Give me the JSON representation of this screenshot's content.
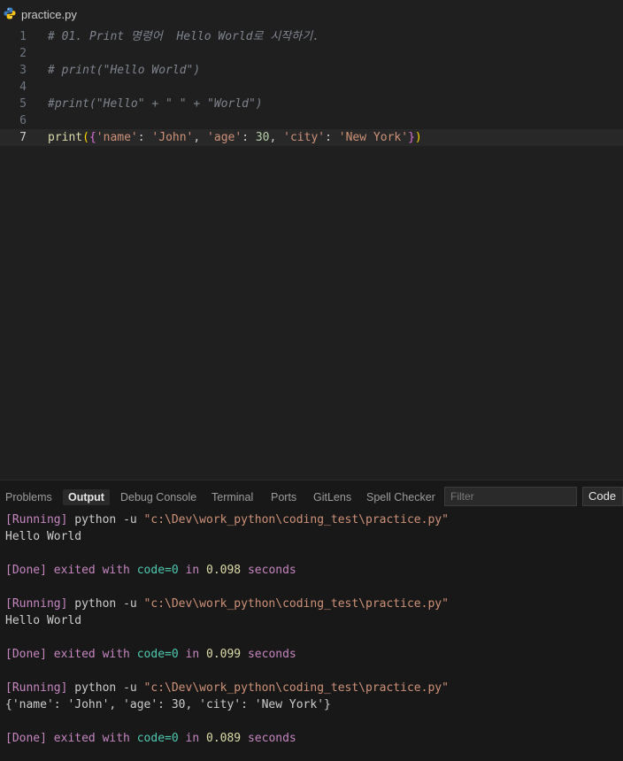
{
  "header": {
    "file_name": "practice.py",
    "file_icon": "python-icon"
  },
  "editor": {
    "lines": [
      {
        "num": "1",
        "text": "# 01. Print 명령어  Hello World로 시작하기."
      },
      {
        "num": "2",
        "text": ""
      },
      {
        "num": "3",
        "text": "# print(\"Hello World\")"
      },
      {
        "num": "4",
        "text": ""
      },
      {
        "num": "5",
        "text": "#print(\"Hello\" + \" \" + \"World\")"
      },
      {
        "num": "6",
        "text": ""
      },
      {
        "num": "7",
        "text": "print({'name': 'John', 'age': 30, 'city': 'New York'})"
      }
    ],
    "line7": {
      "fn": "print",
      "open": "(",
      "brace_open": "{",
      "k1": "'name'",
      "v1": "'John'",
      "k2": "'age'",
      "v2": "30",
      "k3": "'city'",
      "v3": "'New York'",
      "brace_close": "}",
      "close": ")"
    }
  },
  "panel": {
    "tabs": [
      "Problems",
      "Output",
      "Debug Console",
      "Terminal",
      "Ports",
      "GitLens",
      "Spell Checker"
    ],
    "active_tab": "Output",
    "filter_placeholder": "Filter",
    "channel": "Code",
    "output": [
      {
        "running": "[Running]",
        "cmd": " python -u ",
        "path": "\"c:\\Dev\\work_python\\coding_test\\practice.py\""
      },
      {
        "text": "Hello World"
      },
      {
        "done": "[Done]",
        "pre": " exited with ",
        "code": "code=0",
        "in": " in ",
        "time": "0.098",
        "unit": " seconds"
      },
      {
        "running": "[Running]",
        "cmd": " python -u ",
        "path": "\"c:\\Dev\\work_python\\coding_test\\practice.py\""
      },
      {
        "text": "Hello World"
      },
      {
        "done": "[Done]",
        "pre": " exited with ",
        "code": "code=0",
        "in": " in ",
        "time": "0.099",
        "unit": " seconds"
      },
      {
        "running": "[Running]",
        "cmd": " python -u ",
        "path": "\"c:\\Dev\\work_python\\coding_test\\practice.py\""
      },
      {
        "text": "{'name': 'John', 'age': 30, 'city': 'New York'}"
      },
      {
        "done": "[Done]",
        "pre": " exited with ",
        "code": "code=0",
        "in": " in ",
        "time": "0.089",
        "unit": " seconds"
      }
    ]
  }
}
